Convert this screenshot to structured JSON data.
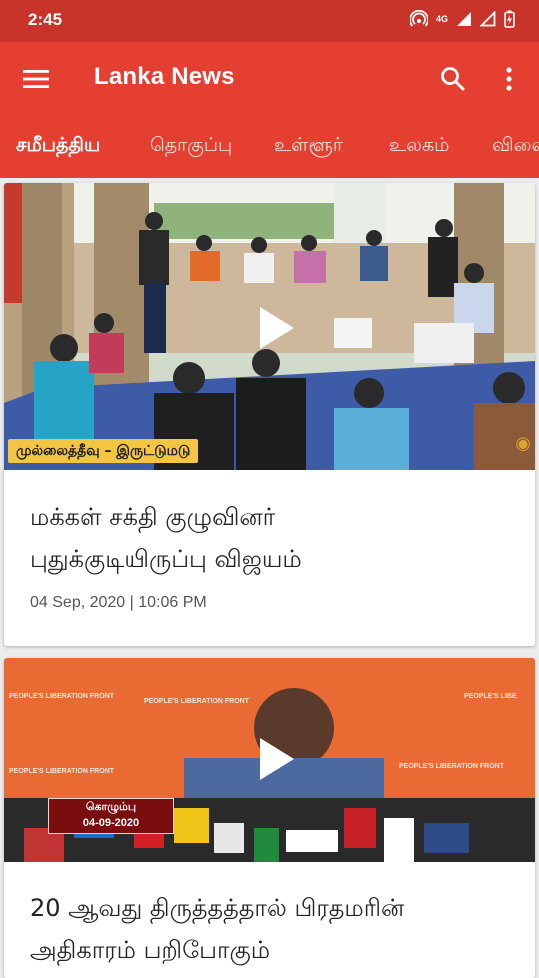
{
  "status_bar": {
    "time": "2:45",
    "network": "4G",
    "icons": [
      "hotspot-icon",
      "signal-icon",
      "signal-outline-icon",
      "battery-charging-icon"
    ]
  },
  "app_bar": {
    "title": "Lanka News",
    "icons": [
      "menu-icon",
      "search-icon",
      "more-vert-icon"
    ]
  },
  "tabs": [
    {
      "label": "சமீபத்திய",
      "active": true
    },
    {
      "label": "தொகுப்பு",
      "active": false
    },
    {
      "label": "உள்ளூர்",
      "active": false
    },
    {
      "label": "உலகம்",
      "active": false
    },
    {
      "label": "விளை",
      "active": false
    }
  ],
  "articles": [
    {
      "headline_line1": "மக்கள் சக்தி குழுவினர்",
      "headline_line2": "புதுக்குடியிருப்பு விஜயம்",
      "date": "04 Sep, 2020 | 10:06 PM",
      "caption": "முல்லைத்தீவு – இருட்டுமடு",
      "video": true
    },
    {
      "headline_line1": "20 ஆவது திருத்தத்தால் பிரதமரின்",
      "headline_line2": "அதிகாரம் பறிபோகும்",
      "date_tag_line1": "கொழும்பு",
      "date_tag_line2": "04-09-2020",
      "banner_text": "PEOPLE'S LIBERATION FRONT",
      "video": true
    }
  ],
  "colors": {
    "status_bar": "#c8342a",
    "app_bar": "#e53f32",
    "background": "#ececec"
  }
}
